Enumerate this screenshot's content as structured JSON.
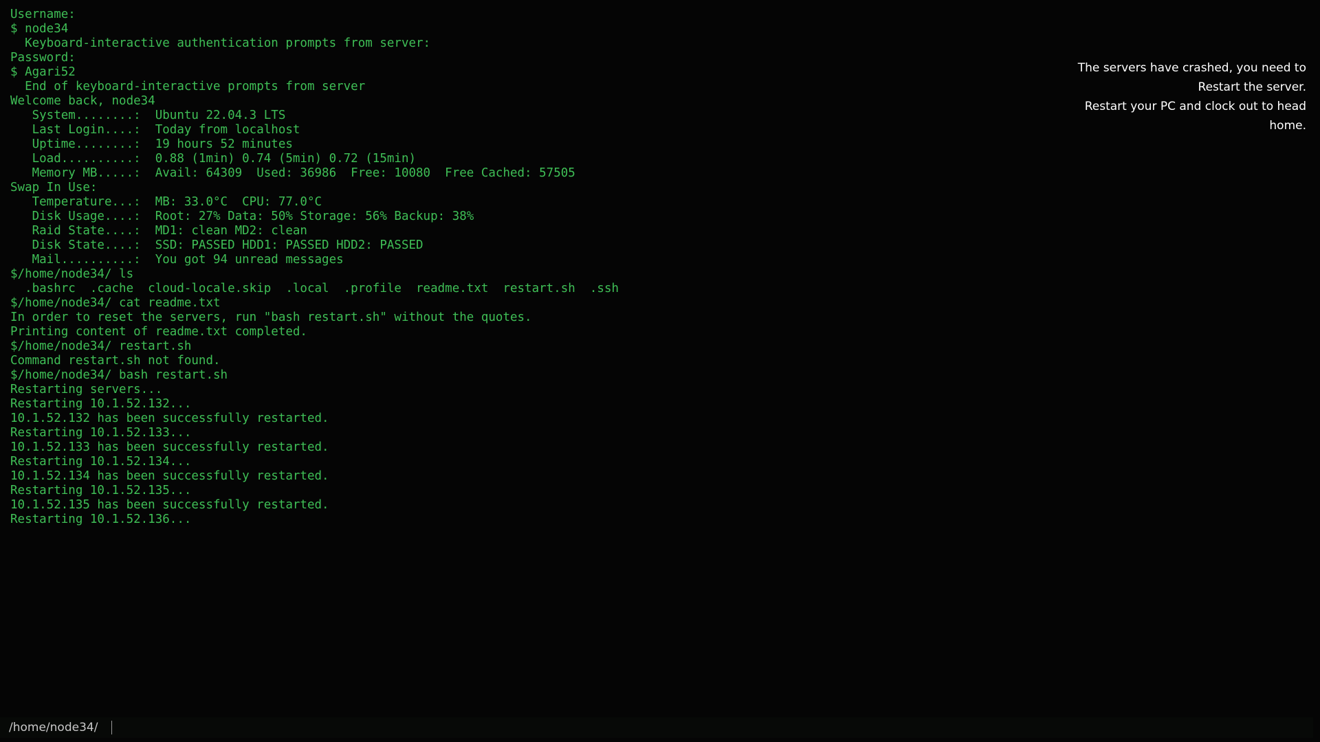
{
  "terminal": {
    "lines": [
      "Username:",
      "$ node34",
      "  Keyboard-interactive authentication prompts from server:",
      "Password:",
      "$ Agari52",
      "  End of keyboard-interactive prompts from server",
      "Welcome back, node34",
      "   System........:  Ubuntu 22.04.3 LTS",
      "   Last Login....:  Today from localhost",
      "   Uptime........:  19 hours 52 minutes",
      "   Load..........:  0.88 (1min) 0.74 (5min) 0.72 (15min)",
      "   Memory MB.....:  Avail: 64309  Used: 36986  Free: 10080  Free Cached: 57505",
      "Swap In Use:",
      "   Temperature...:  MB: 33.0°C  CPU: 77.0°C",
      "   Disk Usage....:  Root: 27% Data: 50% Storage: 56% Backup: 38%",
      "   Raid State....:  MD1: clean MD2: clean",
      "   Disk State....:  SSD: PASSED HDD1: PASSED HDD2: PASSED",
      "   Mail..........:  You got 94 unread messages",
      "$/home/node34/ ls",
      "  .bashrc  .cache  cloud-locale.skip  .local  .profile  readme.txt  restart.sh  .ssh",
      "$/home/node34/ cat readme.txt",
      "In order to reset the servers, run \"bash restart.sh\" without the quotes.",
      "Printing content of readme.txt completed.",
      "$/home/node34/ restart.sh",
      "Command restart.sh not found.",
      "$/home/node34/ bash restart.sh",
      "Restarting servers...",
      "Restarting 10.1.52.132...",
      "10.1.52.132 has been successfully restarted.",
      "Restarting 10.1.52.133...",
      "10.1.52.133 has been successfully restarted.",
      "Restarting 10.1.52.134...",
      "10.1.52.134 has been successfully restarted.",
      "Restarting 10.1.52.135...",
      "10.1.52.135 has been successfully restarted.",
      "Restarting 10.1.52.136..."
    ],
    "text_color": "#3fbf56",
    "background": "#050505"
  },
  "notice": {
    "lines": [
      "The servers have crashed, you need to",
      "Restart the server.",
      "Restart your PC and clock out to head",
      "home."
    ],
    "color": "#ffffff"
  },
  "prompt": {
    "path": "/home/node34/",
    "value": ""
  }
}
